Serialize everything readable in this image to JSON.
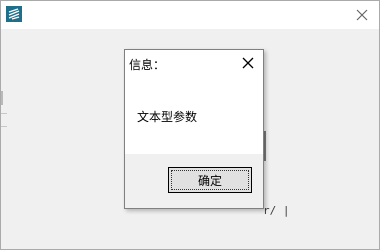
{
  "window": {
    "app_icon": "app-logo-icon",
    "close_icon": "close-icon"
  },
  "behind": {
    "fragment": "r/ | "
  },
  "dialog": {
    "title": "信息：",
    "message": "文本型参数",
    "ok_label": "确定",
    "close_icon": "close-icon"
  },
  "colors": {
    "icon_teal": "#1f6f8b",
    "window_bg": "#f0f0f0",
    "button_bg": "#e1e1e1"
  }
}
